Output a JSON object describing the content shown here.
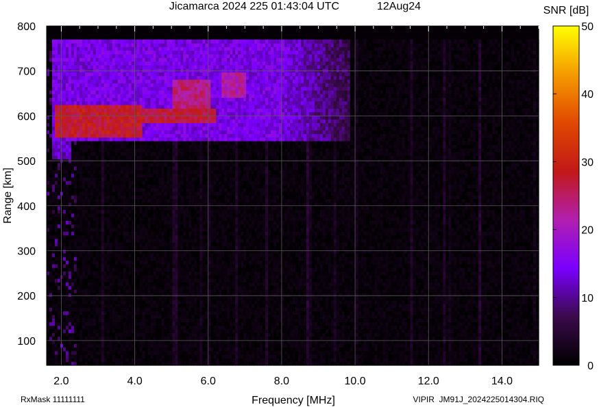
{
  "chart_data": {
    "type": "heatmap",
    "title": {
      "main": "Jicamarca 2024 225 01:43:04 UTC",
      "date": "12Aug24"
    },
    "xlabel": "Frequency [MHz]",
    "ylabel": "Range [km]",
    "colorbar_label": "SNR [dB]",
    "xlim": [
      1.6,
      15.0
    ],
    "ylim": [
      45,
      800
    ],
    "x_ticks": [
      "2.0",
      "4.0",
      "6.0",
      "8.0",
      "10.0",
      "12.0",
      "14.0"
    ],
    "x_tick_values": [
      2,
      4,
      6,
      8,
      10,
      12,
      14
    ],
    "y_ticks": [
      "100",
      "200",
      "300",
      "400",
      "500",
      "600",
      "700",
      "800"
    ],
    "y_tick_values": [
      100,
      200,
      300,
      400,
      500,
      600,
      700,
      800
    ],
    "colorbar_range": [
      0,
      50
    ],
    "colorbar_ticks": [
      "0",
      "10",
      "20",
      "30",
      "40",
      "50"
    ],
    "colorbar_tick_values": [
      0,
      10,
      20,
      30,
      40,
      50
    ],
    "colormap": [
      "#000000",
      "#3a0a4a",
      "#7a00ff",
      "#b21fb0",
      "#c21818",
      "#e04800",
      "#f59a00",
      "#ffff00"
    ],
    "grid": true,
    "data_top_km": 770,
    "echo_regions": [
      {
        "freq_mhz": [
          1.7,
          9.8
        ],
        "range_km": [
          540,
          770
        ],
        "snr_db": 14
      },
      {
        "freq_mhz": [
          1.7,
          2.2
        ],
        "range_km": [
          500,
          540
        ],
        "snr_db": 12
      },
      {
        "freq_mhz": [
          1.8,
          4.2
        ],
        "range_km": [
          545,
          620
        ],
        "snr_db": 28
      },
      {
        "freq_mhz": [
          4.2,
          6.2
        ],
        "range_km": [
          580,
          610
        ],
        "snr_db": 27
      },
      {
        "freq_mhz": [
          5.0,
          6.0
        ],
        "range_km": [
          610,
          680
        ],
        "snr_db": 24
      },
      {
        "freq_mhz": [
          6.3,
          7.0
        ],
        "range_km": [
          640,
          690
        ],
        "snr_db": 22
      }
    ],
    "footer_left": "RxMask 11111111",
    "footer_right": "VIPIR  JM91J_2024225014304.RIQ"
  }
}
